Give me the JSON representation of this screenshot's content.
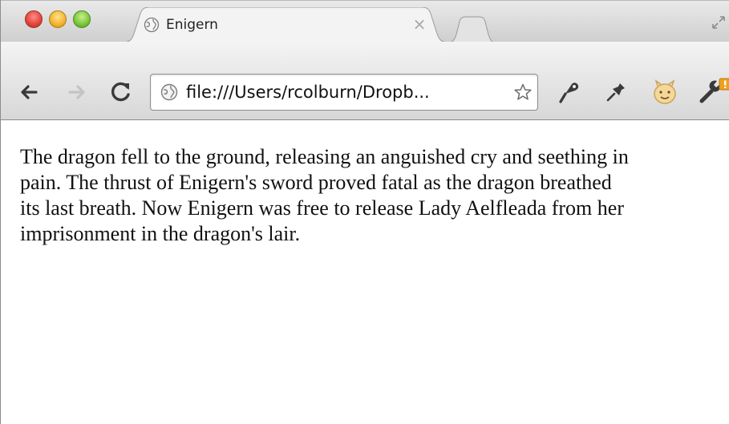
{
  "browser": {
    "tab": {
      "title": "Enigern",
      "close_glyph": "×",
      "favicon": "globe-icon"
    },
    "window_controls": [
      "close",
      "minimize",
      "zoom"
    ],
    "address_bar": {
      "value": "file:///Users/rcolburn/Dropb...",
      "page_icon": "globe-icon",
      "bookmark_icon": "star-icon"
    },
    "toolbar_icons": [
      "back-arrow-icon",
      "forward-arrow-icon",
      "reload-icon",
      "pen-icon",
      "pin-icon",
      "extension-face-icon",
      "wrench-menu-icon"
    ],
    "colors": {
      "close": "#e0433a",
      "minimize": "#f2b22c",
      "zoom": "#79c43a",
      "update_badge": "#f0a020"
    }
  },
  "page": {
    "text": "The dragon fell to the ground, releasing an anguished cry and seething in\npain. The thrust of Enigern's sword proved fatal as the dragon breathed\nits last breath. Now Enigern was free to release Lady Aelfleada from her\nimprisonment in the dragon's lair."
  }
}
